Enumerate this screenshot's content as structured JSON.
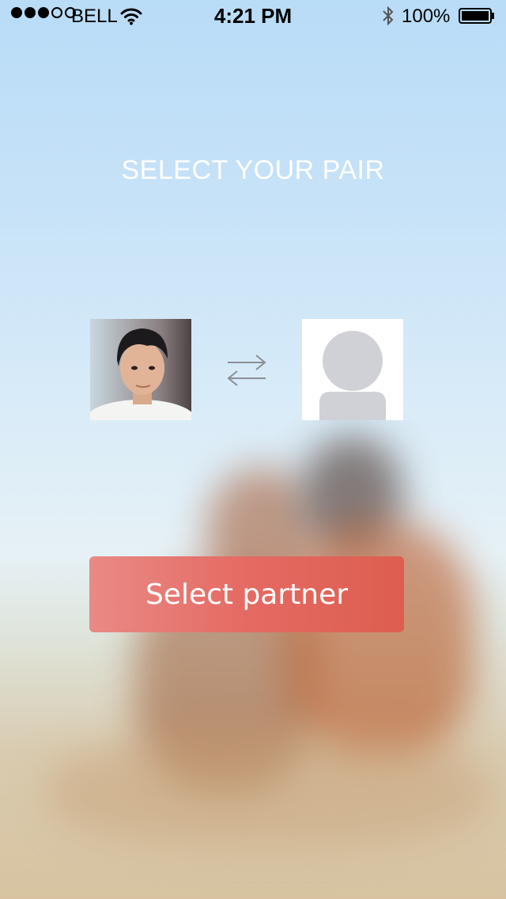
{
  "status_bar": {
    "signal_bars_filled": 3,
    "signal_bars_total": 5,
    "carrier": "BELL",
    "time": "4:21 PM",
    "battery_percent": "100%",
    "icons": [
      "signal-icon",
      "wifi-icon",
      "bluetooth-icon",
      "battery-icon"
    ]
  },
  "screen": {
    "title": "SELECT YOUR PAIR",
    "user_avatar": "user-photo",
    "partner_avatar": "placeholder-avatar-icon",
    "swap_icon": "swap-arrows-icon",
    "select_button_label": "Select partner"
  },
  "colors": {
    "button_start": "#e98a85",
    "button_end": "#dd5e50",
    "title_text": "#ffffff",
    "placeholder_gray": "#cfd1d6"
  }
}
